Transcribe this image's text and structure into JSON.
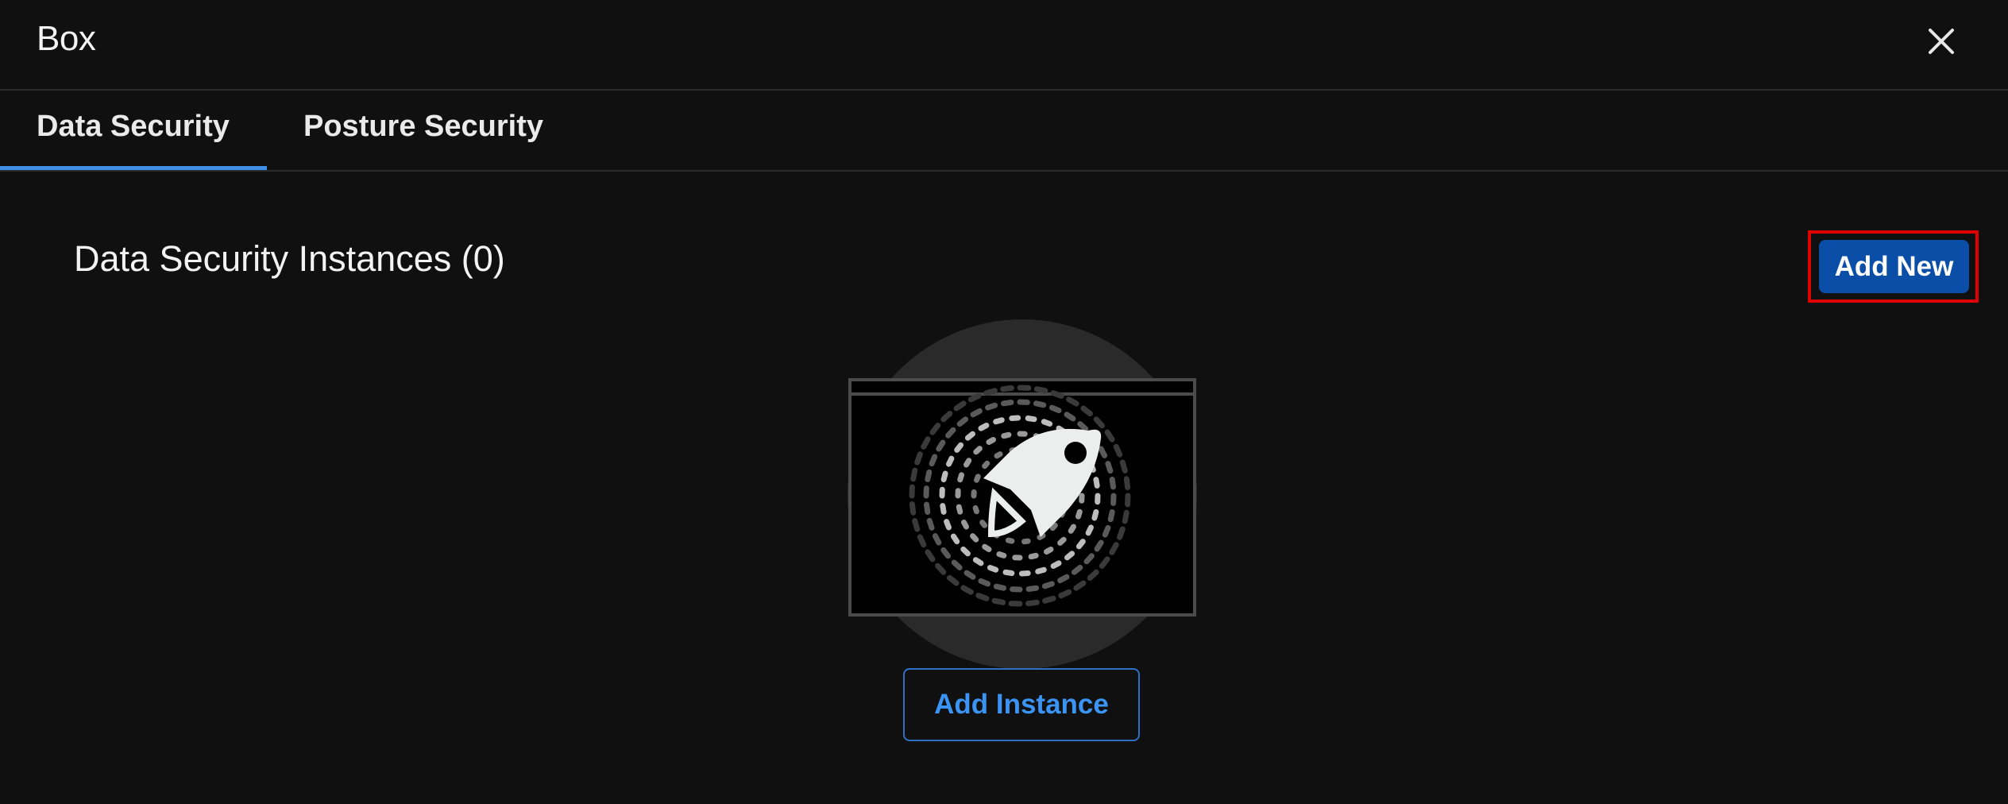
{
  "window": {
    "title": "Box",
    "close_icon": "close-icon"
  },
  "tabs": [
    {
      "label": "Data Security",
      "active": true
    },
    {
      "label": "Posture Security",
      "active": false
    }
  ],
  "main": {
    "section_title": "Data Security Instances (0)",
    "add_new_label": "Add New",
    "illustration_icon": "rocket-icon",
    "add_instance_label": "Add Instance"
  },
  "colors": {
    "background": "#101010",
    "accent": "#3d8fe8",
    "primary_button": "#0b4ea8",
    "highlight_box": "#e00000"
  }
}
